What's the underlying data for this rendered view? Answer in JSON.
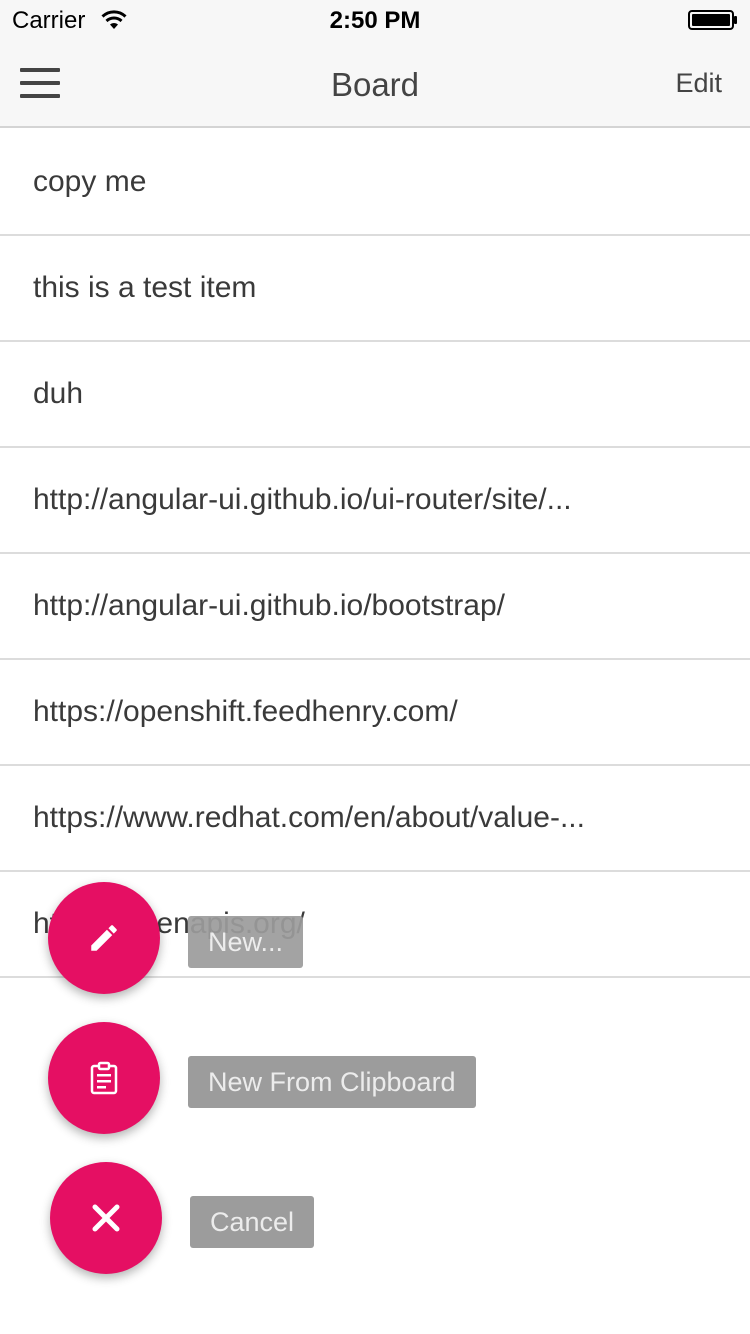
{
  "status_bar": {
    "carrier": "Carrier",
    "time": "2:50 PM"
  },
  "nav": {
    "title": "Board",
    "edit_label": "Edit",
    "menu_icon": "hamburger-menu-icon"
  },
  "list": {
    "items": [
      "copy me",
      "this is a test item",
      "duh",
      "http://angular-ui.github.io/ui-router/site/...",
      "http://angular-ui.github.io/bootstrap/",
      "https://openshift.feedhenry.com/",
      "https://www.redhat.com/en/about/value-...",
      "https://openapis.org/"
    ]
  },
  "fab_menu": {
    "new": {
      "label": "New...",
      "icon": "pencil-icon"
    },
    "clipboard": {
      "label": "New From Clipboard",
      "icon": "clipboard-icon"
    },
    "cancel": {
      "label": "Cancel",
      "icon": "close-icon"
    }
  },
  "colors": {
    "fab": "#e50f63",
    "label_bg": "#9c9c9c",
    "bar_bg": "#f7f7f7"
  }
}
